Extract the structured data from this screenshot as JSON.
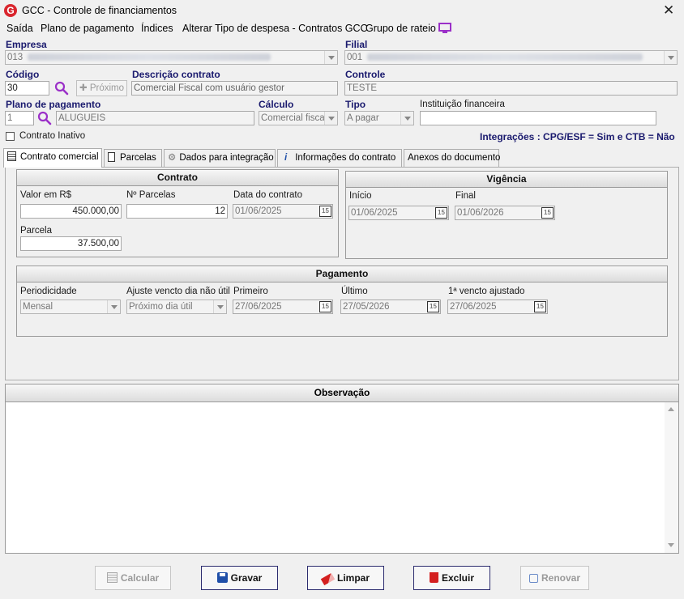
{
  "window": {
    "title": "GCC - Controle de financiamentos",
    "logo_letter": "G"
  },
  "menu": [
    "Saída",
    "Plano de pagamento",
    "Índices",
    "Alterar Tipo de despesa - Contratos GCC",
    "Grupo de rateio"
  ],
  "header": {
    "empresa_label": "Empresa",
    "empresa_value": "013",
    "filial_label": "Filial",
    "filial_value": "001",
    "codigo_label": "Código",
    "codigo_value": "30",
    "proximo_label": "Próximo",
    "descricao_label": "Descrição contrato",
    "descricao_value": "Comercial Fiscal com usuário gestor",
    "controle_label": "Controle",
    "controle_value": "TESTE",
    "plano_label": "Plano de pagamento",
    "plano_code": "1",
    "plano_name": "ALUGUEIS",
    "calculo_label": "Cálculo",
    "calculo_value": "Comercial fiscal",
    "tipo_label": "Tipo",
    "tipo_value": "A pagar",
    "instituicao_label": "Instituição financeira",
    "instituicao_value": "",
    "contrato_inativo_label": "Contrato Inativo",
    "integracoes": "Integrações : CPG/ESF = Sim e CTB = Não"
  },
  "tabs": [
    "Contrato comercial",
    "Parcelas",
    "Dados para integração",
    "Informações do contrato",
    "Anexos do documento"
  ],
  "contrato": {
    "title": "Contrato",
    "valor_label": "Valor em R$",
    "valor_value": "450.000,00",
    "nparcelas_label": "Nº Parcelas",
    "nparcelas_value": "12",
    "data_label": "Data do contrato",
    "data_value": "01/06/2025",
    "parcela_label": "Parcela",
    "parcela_value": "37.500,00"
  },
  "vigencia": {
    "title": "Vigência",
    "inicio_label": "Início",
    "inicio_value": "01/06/2025",
    "final_label": "Final",
    "final_value": "01/06/2026"
  },
  "pagamento": {
    "title": "Pagamento",
    "periodicidade_label": "Periodicidade",
    "periodicidade_value": "Mensal",
    "ajuste_label": "Ajuste vencto dia não útil",
    "ajuste_value": "Próximo dia útil",
    "primeiro_label": "Primeiro",
    "primeiro_value": "27/06/2025",
    "ultimo_label": "Último",
    "ultimo_value": "27/05/2026",
    "ajustado_label": "1ª vencto ajustado",
    "ajustado_value": "27/06/2025"
  },
  "calendar_icon_text": "15",
  "observacao": {
    "title": "Observação",
    "value": ""
  },
  "buttons": {
    "calcular": "Calcular",
    "gravar": "Gravar",
    "limpar": "Limpar",
    "excluir": "Excluir",
    "renovar": "Renovar"
  },
  "colors": {
    "label_blue": "#1a1a6e",
    "logo_red": "#d9262e",
    "search_purple": "#9b30c8",
    "delete_red": "#d42020",
    "save_blue": "#1f4fa8"
  }
}
